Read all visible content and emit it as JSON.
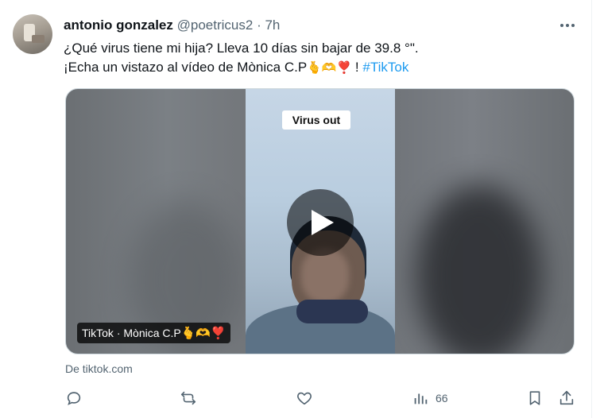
{
  "tweet": {
    "author_name": "antonio gonzalez",
    "handle": "@poetricus2",
    "separator": "·",
    "time": "7h",
    "line1": "¿Qué virus tiene mi hija? Lleva 10 días sin bajar de 39.8 °\".",
    "line2_prefix": "¡Echa un vistazo al vídeo de Mònica C.P",
    "line2_emojis": "🫰🫶❣️",
    "line2_suffix": " ! ",
    "hashtag": "#TikTok"
  },
  "media": {
    "overlay_label": "Virus out",
    "source_label": "TikTok · Mònica C.P",
    "source_emojis": "🫰🫶❣️",
    "play_icon": "play-icon"
  },
  "card": {
    "from_text": "De tiktok.com"
  },
  "actions": {
    "reply_icon": "reply-icon",
    "retweet_icon": "retweet-icon",
    "like_icon": "like-icon",
    "views_icon": "views-icon",
    "views_count": "66",
    "bookmark_icon": "bookmark-icon",
    "share_icon": "share-icon"
  },
  "colors": {
    "link": "#1d9bf0",
    "secondary_text": "#536471",
    "primary_text": "#0f1419"
  }
}
